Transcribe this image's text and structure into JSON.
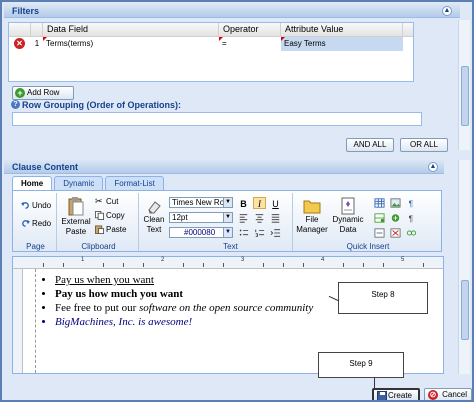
{
  "filters": {
    "title": "Filters",
    "columns": [
      "Data Field",
      "Operator",
      "Attribute Value"
    ],
    "rows": [
      {
        "num": "1",
        "field": "Terms(terms)",
        "operator": "=",
        "value": "Easy Terms"
      }
    ],
    "add_row_label": "Add Row",
    "grouping_label": "Row Grouping (Order of Operations):",
    "and_all_label": "AND ALL",
    "or_all_label": "OR ALL"
  },
  "clause": {
    "title": "Clause Content",
    "tabs": [
      {
        "label": "Home",
        "active": true
      },
      {
        "label": "Dynamic",
        "active": false
      },
      {
        "label": "Format-List",
        "active": false
      }
    ]
  },
  "ribbon": {
    "page": {
      "label": "Page",
      "undo": "Undo",
      "redo": "Redo"
    },
    "clipboard": {
      "label": "Clipboard",
      "external_paste_1": "External",
      "external_paste_2": "Paste",
      "cut": "Cut",
      "copy": "Copy",
      "paste": "Paste"
    },
    "clean": {
      "line1": "Clean",
      "line2": "Text"
    },
    "text": {
      "label": "Text",
      "font": "Times New Rom",
      "size": "12pt",
      "color": "#000080",
      "bold": "B",
      "italic": "I",
      "underline": "U"
    },
    "insert": {
      "label": "Quick Insert",
      "file_manager_1": "File",
      "file_manager_2": "Manager",
      "dynamic_data_1": "Dynamic",
      "dynamic_data_2": "Data"
    }
  },
  "editor": {
    "ruler_numbers": [
      "1",
      "2",
      "3",
      "4",
      "5"
    ],
    "bullets": [
      "Pay us when you want",
      "Pay us how much you want",
      "Fee free to put our ",
      "software on the open source community",
      "BigMachines, Inc. is awesome!"
    ]
  },
  "callouts": {
    "step8": "Step 8",
    "step9": "Step 9"
  },
  "actions": {
    "create": "Create",
    "cancel": "Cancel"
  },
  "colors": {
    "accent": "#15428b",
    "panel": "#dfe8f6",
    "border": "#99bbe8",
    "selected": "#c6d9f1",
    "editor_text_color": "#000080"
  }
}
